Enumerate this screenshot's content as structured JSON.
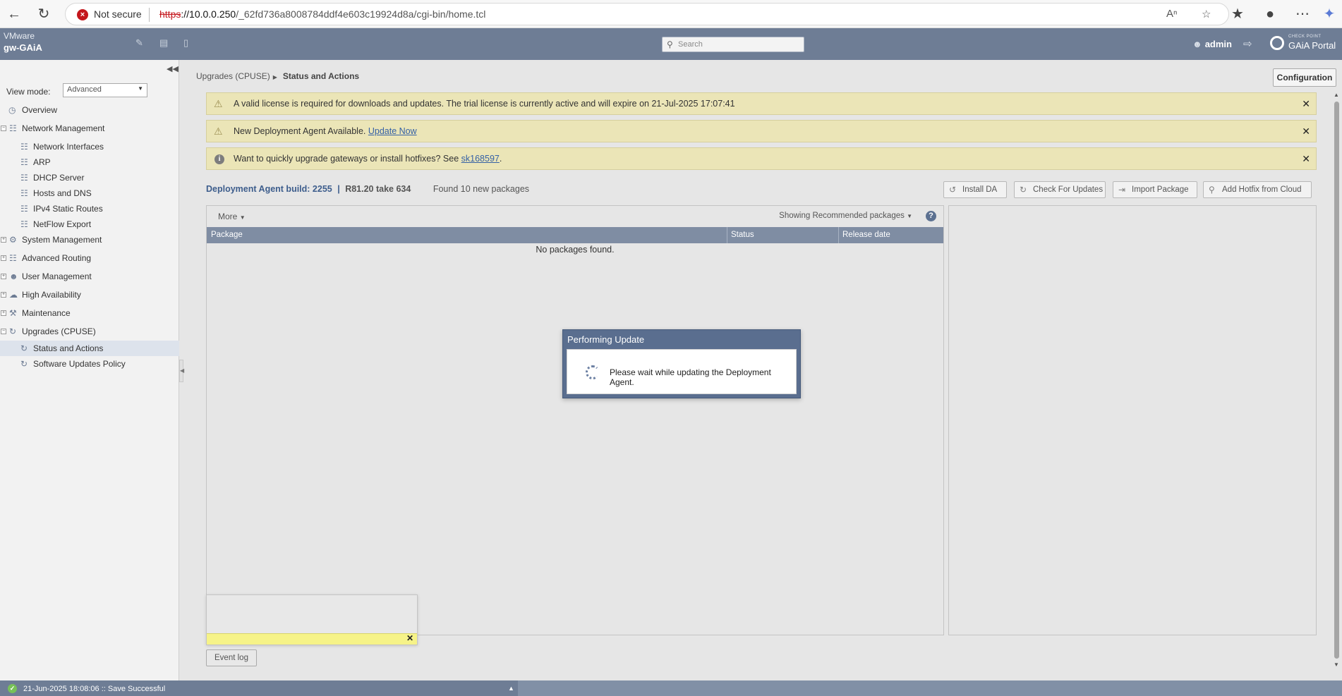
{
  "browser": {
    "not_secure": "Not secure",
    "url_proto": "https",
    "url_host": "://10.0.0.250",
    "url_path": "/_62fd736a8008784ddf4e603c19924d8a/cgi-bin/home.tcl"
  },
  "header": {
    "vendor": "VMware",
    "hostname": "gw-GAiA",
    "search_placeholder": "Search",
    "user": "admin",
    "brand_small": "CHECK POINT",
    "brand": "GAiA Portal"
  },
  "sidebar": {
    "view_mode_label": "View mode:",
    "view_mode_value": "Advanced",
    "items": [
      {
        "label": "Overview"
      },
      {
        "label": "Network Management"
      },
      {
        "label": "Network Interfaces"
      },
      {
        "label": "ARP"
      },
      {
        "label": "DHCP Server"
      },
      {
        "label": "Hosts and DNS"
      },
      {
        "label": "IPv4 Static Routes"
      },
      {
        "label": "NetFlow Export"
      },
      {
        "label": "System Management"
      },
      {
        "label": "Advanced Routing"
      },
      {
        "label": "User Management"
      },
      {
        "label": "High Availability"
      },
      {
        "label": "Maintenance"
      },
      {
        "label": "Upgrades (CPUSE)"
      },
      {
        "label": "Status and Actions"
      },
      {
        "label": "Software Updates Policy"
      }
    ]
  },
  "main": {
    "breadcrumb_parent": "Upgrades (CPUSE)",
    "breadcrumb_current": "Status and Actions",
    "config_button": "Configuration",
    "alerts": [
      {
        "text": "A valid license is required for downloads and updates. The trial license is currently active and will expire on 21-Jul-2025 17:07:41"
      },
      {
        "text": "New Deployment Agent Available. ",
        "link": "Update Now"
      },
      {
        "text": "Want to quickly upgrade gateways or install hotfixes? See ",
        "link": "sk168597",
        "suffix": "."
      }
    ],
    "da_build": "Deployment Agent build: 2255",
    "separator": "|",
    "version": "R81.20 take 634",
    "found": "Found 10 new packages",
    "actions": {
      "install_da": "Install DA",
      "check_updates": "Check For Updates",
      "import_package": "Import Package",
      "add_hotfix": "Add Hotfix from Cloud"
    },
    "more": "More",
    "showing": "Showing Recommended packages",
    "columns": {
      "package": "Package",
      "status": "Status",
      "release": "Release date"
    },
    "empty": "No packages found.",
    "event_log": "Event log"
  },
  "modal": {
    "title": "Performing Update",
    "message": "Please wait while updating the Deployment Agent."
  },
  "status": {
    "text": "21-Jun-2025 18:08:06 :: Save Successful"
  }
}
